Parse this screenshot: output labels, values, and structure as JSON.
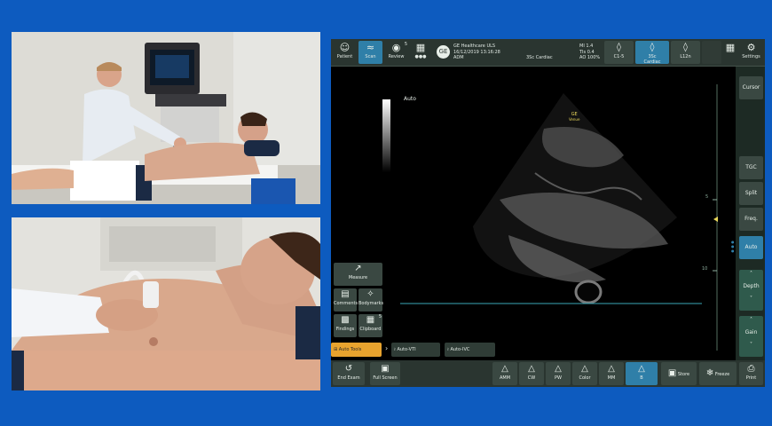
{
  "colors": {
    "accent": "#2f7fa8",
    "background": "#0d5bbf",
    "panel": "#2a3530"
  },
  "header": {
    "patient": "Patient",
    "scan": "Scan",
    "review": "Review",
    "review_count": "5",
    "device": "GE Healthcare ULS",
    "datetime": "16/12/2019 13:16:28",
    "user": "ADM",
    "preset": "3Sc  Cardiac",
    "mi": "MI 1.4",
    "tis": "TIs 0.4",
    "ao": "AO 100%",
    "probe_c1": "C1-5",
    "probe_3sc": "3Sc",
    "probe_3sc_sub": "Cardiac",
    "probe_l12": "L12n",
    "settings": "Settings"
  },
  "image": {
    "auto": "Auto",
    "logo": "GE",
    "logo_sub": "Venue",
    "depth_5": "5",
    "depth_10": "10"
  },
  "right": {
    "cursor": "Cursor",
    "tgc": "TGC",
    "split": "Split",
    "freq": "Freq.",
    "auto": "Auto",
    "depth": "Depth",
    "gain": "Gain"
  },
  "tools": {
    "measure": "Measure",
    "comments": "Comments",
    "bodymarks": "Bodymarks",
    "findings": "Findings",
    "clipboard": "Clipboard",
    "clipboard_count": "5",
    "auto_tools": "Auto Tools",
    "auto_vti": "Auto-VTI",
    "auto_ivc": "Auto-IVC"
  },
  "bottom": {
    "end_exam": "End Exam",
    "full_screen": "Full Screen",
    "amm": "AMM",
    "cw": "CW",
    "pw": "PW",
    "color": "Color",
    "mm": "MM",
    "b": "B",
    "store": "Store",
    "freeze": "Freeze",
    "print": "Print"
  }
}
